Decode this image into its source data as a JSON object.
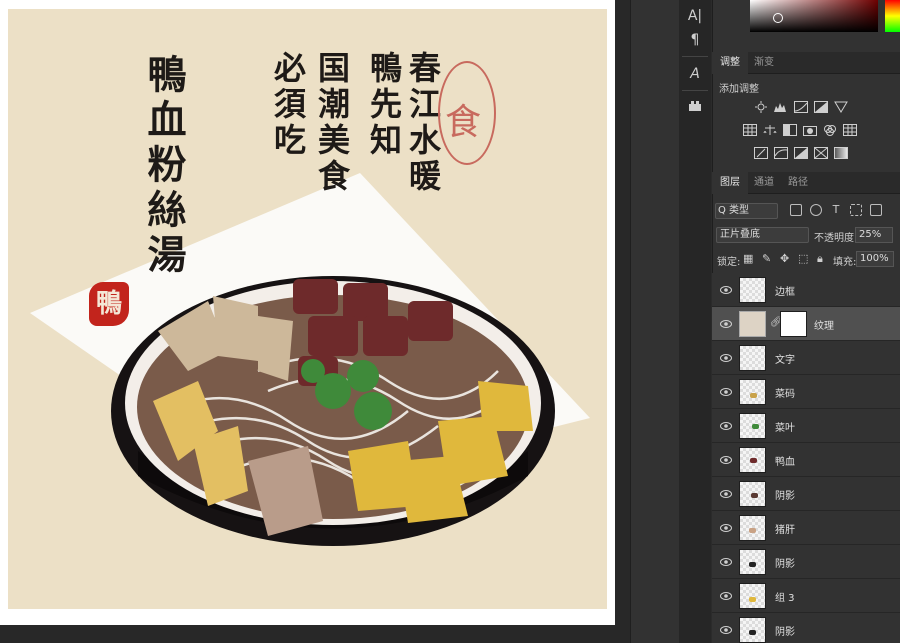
{
  "artwork": {
    "title": "鴨血粉絲湯",
    "poem_lines": [
      "春江水暖",
      "鴨先知",
      "国潮美食",
      "必須吃"
    ],
    "seal_glyph": "食",
    "red_seal_glyph": "鴨"
  },
  "toolbar": {
    "character_tool": "A|",
    "paragraph_tool": "¶",
    "glyph_tool": "A",
    "properties_tool": "⋯"
  },
  "adjustments_panel": {
    "tabs": [
      {
        "label": "调整"
      },
      {
        "label": "渐变"
      }
    ],
    "add_adjustment_label": "添加调整"
  },
  "layers_panel": {
    "tabs": [
      {
        "label": "图层"
      },
      {
        "label": "通道"
      },
      {
        "label": "路径"
      }
    ],
    "filter_kind": "Q 类型",
    "blend_mode": "正片叠底",
    "opacity_label": "不透明度:",
    "opacity_value": "25%",
    "lock_label": "锁定:",
    "fill_label": "填充:",
    "fill_value": "100%",
    "layers": [
      {
        "name": "边框"
      },
      {
        "name": "纹理"
      },
      {
        "name": "文字"
      },
      {
        "name": "菜码"
      },
      {
        "name": "菜叶"
      },
      {
        "name": "鸭血"
      },
      {
        "name": "阴影"
      },
      {
        "name": "猪肝"
      },
      {
        "name": "阴影"
      },
      {
        "name": "组 3"
      },
      {
        "name": "阴影"
      }
    ]
  },
  "colors": {
    "canvas_bg": "#ece0c6",
    "panel_bg": "#323232",
    "selected_layer": "#505050",
    "seal_red": "#c2241c"
  }
}
